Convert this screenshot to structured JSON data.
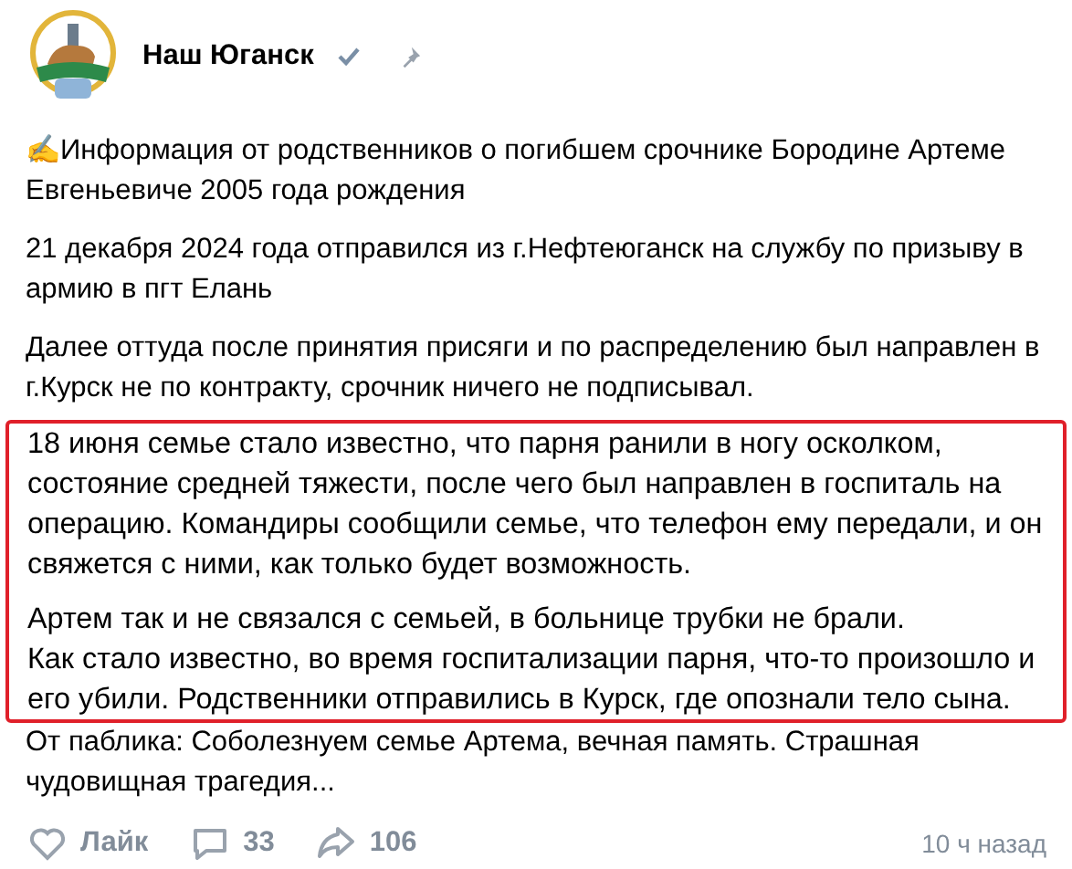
{
  "post": {
    "author": "Наш Юганск",
    "verified": true,
    "pinned": true,
    "paragraphs": [
      {
        "text": "✍Информация от родственников о погибшем срочнике Бородине Артеме Евгеньевиче 2005 года рождения",
        "highlighted": false
      },
      {
        "text": "21 декабря 2024 года отправился из г.Нефтеюганск на службу по призыву в армию в пгт Елань",
        "highlighted": false
      },
      {
        "text": "Далее оттуда после принятия присяги и по распределению был направлен в г.Курск не по контракту, срочник ничего не подписывал.",
        "highlighted": false
      },
      {
        "text": "18 июня семье стало известно, что парня ранили в ногу осколком, состояние средней тяжести, после чего был направлен в госпиталь на операцию. Командиры сообщили семье, что телефон ему передали, и он свяжется с ними, как только будет возможность.",
        "highlighted": true
      },
      {
        "text": "Артем так и не связался с семьей, в больнице трубки не брали.\nКак стало известно, во время госпитализации парня, что-то произошло и его убили. Родственники отправились в Курск, где опознали тело сына.",
        "highlighted": true
      },
      {
        "text": "От паблика: Соболезнуем семье Артема, вечная память. Страшная чудовищная трагедия...",
        "highlighted": false
      }
    ],
    "like_label": "Лайк",
    "comments": "33",
    "shares": "106",
    "time": "10 ч назад"
  }
}
